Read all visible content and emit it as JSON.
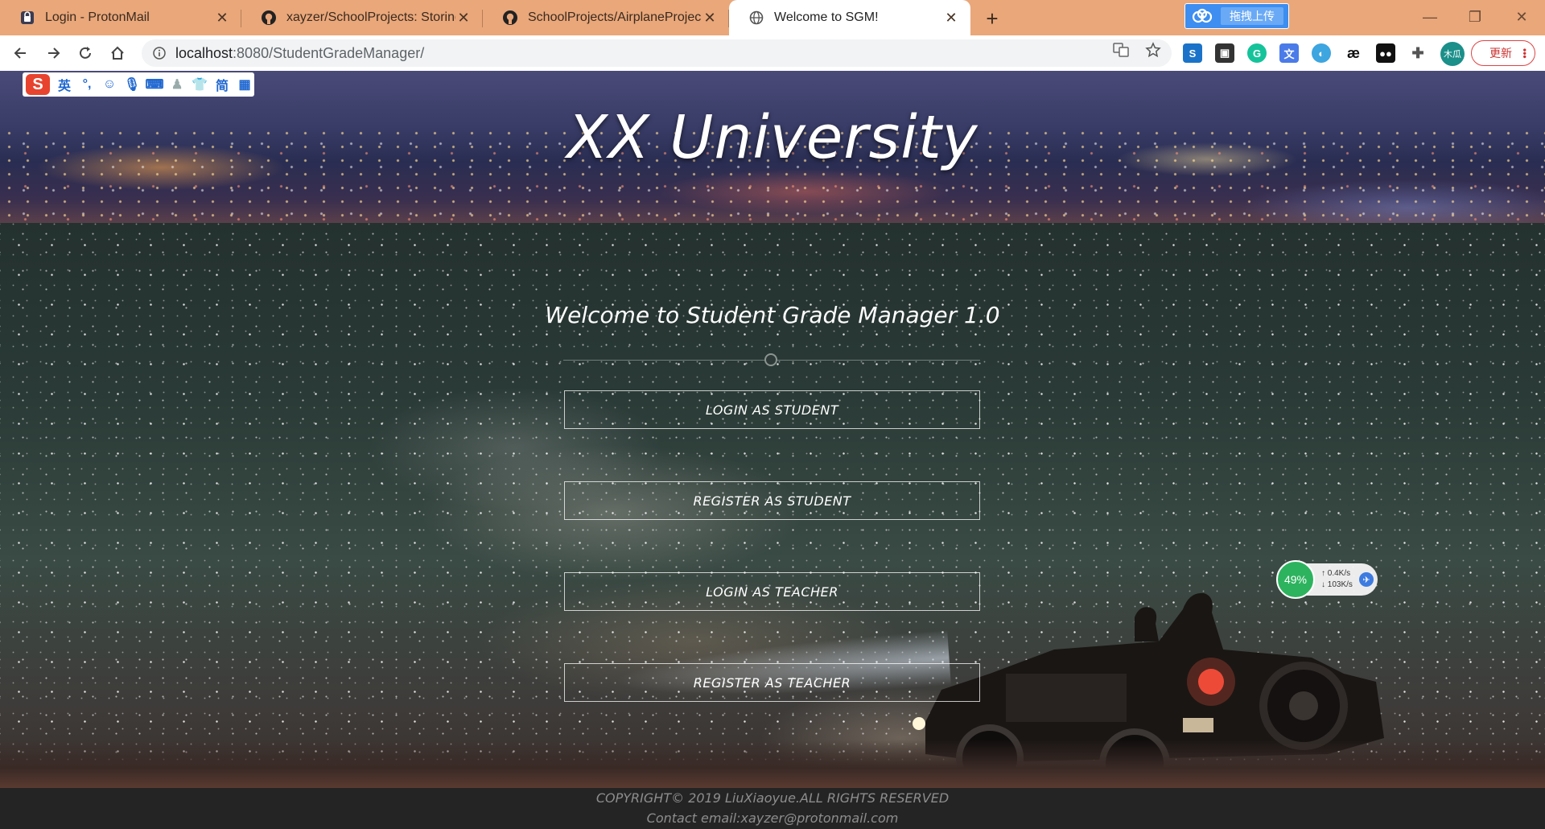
{
  "browser": {
    "tabs": [
      {
        "title": "Login - ProtonMail",
        "icon": "protonmail-icon"
      },
      {
        "title": "xayzer/SchoolProjects: Storing",
        "icon": "github-icon"
      },
      {
        "title": "SchoolProjects/AirplaneProjec",
        "icon": "github-icon"
      },
      {
        "title": "Welcome to SGM!",
        "icon": "globe-icon",
        "active": true
      }
    ],
    "upload_label": "拖拽上传",
    "url_host": "localhost",
    "url_path": ":8080/StudentGradeManager/",
    "profile_label": "木瓜",
    "update_label": "更新"
  },
  "ime": {
    "lang": "英",
    "simp": "简"
  },
  "page": {
    "banner_title": "XX University",
    "welcome": "Welcome to Student Grade Manager 1.0",
    "buttons": [
      "LOGIN AS STUDENT",
      "REGISTER AS STUDENT",
      "LOGIN AS TEACHER",
      "REGISTER AS TEACHER"
    ],
    "footer": {
      "copyright": "COPYRIGHT© 2019 LiuXiaoyue.ALL RIGHTS RESERVED",
      "contact": "Contact email:xayzer@protonmail.com"
    }
  },
  "netmon": {
    "percent": "49%",
    "up": "0.4K/s",
    "down": "103K/s"
  },
  "colors": {
    "tabstrip": "#e9a77a",
    "accent_upload": "#3d8ef0",
    "netmon_green": "#2db35e"
  }
}
